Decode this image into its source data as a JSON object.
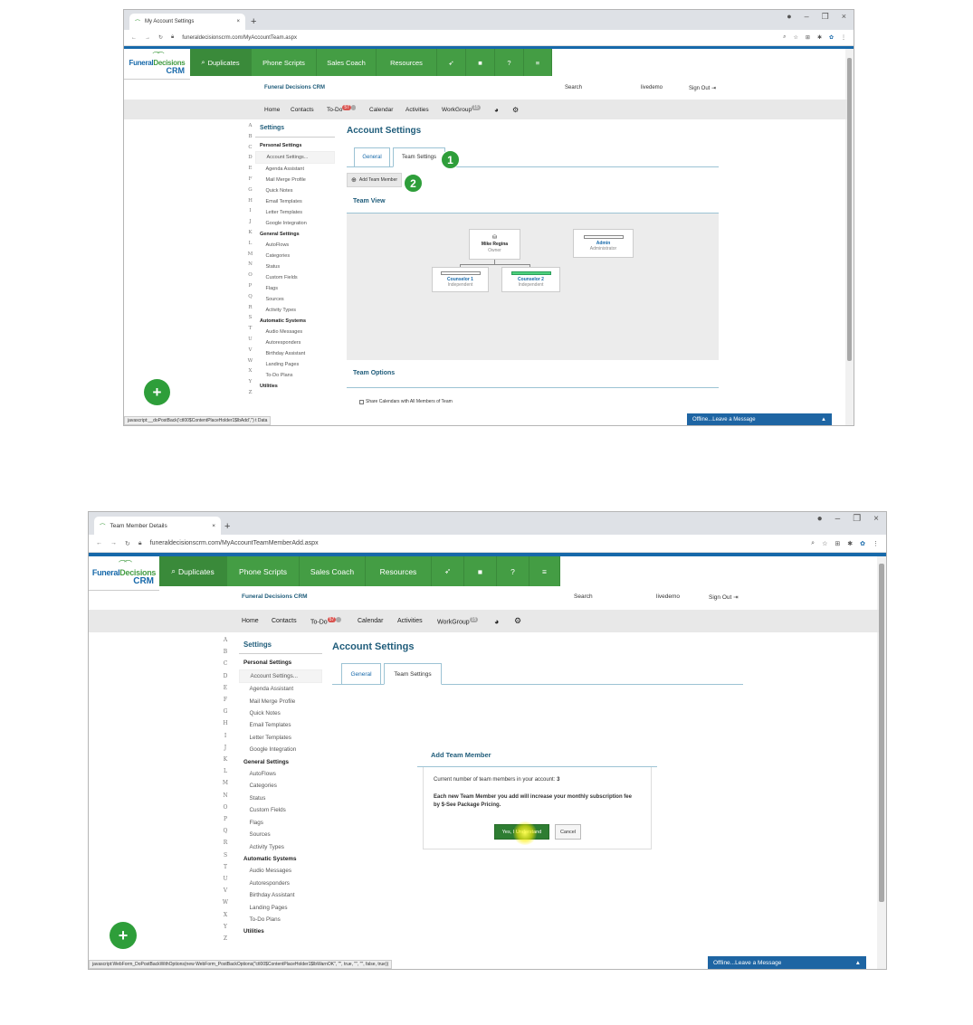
{
  "s1": {
    "tab_title": "My Account Settings",
    "url": "funeraldecisionscrm.com/MyAccountTeam.aspx",
    "page_title": "Account Settings",
    "tabs": [
      "General",
      "Team Settings"
    ],
    "marker1": "1",
    "marker2": "2",
    "add_btn": "Add Team Member",
    "team_view": "Team View",
    "nodes": {
      "owner_name": "Mike Regina",
      "owner_role": "Owner",
      "admin_name": "Admin",
      "admin_role": "Administrator",
      "c1_name": "Counselor 1",
      "c1_role": "Independent",
      "c2_name": "Counselor 2",
      "c2_role": "Independent"
    },
    "team_options": "Team Options",
    "share_cal": "Share Calendars with All Members of Team",
    "status": "javascript:__doPostBack('ctl00$ContentPlaceHolder1$lbAdd','') t Data"
  },
  "s2": {
    "tab_title": "Team Member Details",
    "url": "funeraldecisionscrm.com/MyAccountTeamMemberAdd.aspx",
    "page_title": "Account Settings",
    "tabs": [
      "General",
      "Team Settings"
    ],
    "modal": {
      "title": "Add Team Member",
      "count_prefix": "Current number of team members in your account:",
      "count": "3",
      "warning": "Each new Team Member you add will increase your monthly subscription fee by $-See Package Pricing.",
      "ok": "Yes, I Understand",
      "cancel": "Cancel"
    },
    "status": "javascript:WebForm_DoPostBackWithOptions(new WebForm_PostBackOptions(\"ctl00$ContentPlaceHolder1$lbWarnOK\", \"\", true, \"\", \"\", false, true))"
  },
  "logo": {
    "part1": "Funeral",
    "part2": "Decisions",
    "crm": "CRM"
  },
  "green_nav": {
    "duplicates": "Duplicates",
    "phone_scripts": "Phone Scripts",
    "sales_coach": "Sales Coach",
    "resources": "Resources"
  },
  "sub_header": {
    "brand": "Funeral Decisions CRM",
    "search": "Search",
    "user": "livedemo",
    "signout": "Sign Out"
  },
  "main_nav": {
    "home": "Home",
    "contacts": "Contacts",
    "todo": "To-Do",
    "todo_badge": "57",
    "calendar": "Calendar",
    "activities": "Activities",
    "workgroup": "WorkGroup",
    "workgroup_badge": "15"
  },
  "alphabet": [
    "A",
    "B",
    "C",
    "D",
    "E",
    "F",
    "G",
    "H",
    "I",
    "J",
    "K",
    "L",
    "M",
    "N",
    "O",
    "P",
    "Q",
    "R",
    "S",
    "T",
    "U",
    "V",
    "W",
    "X",
    "Y",
    "Z"
  ],
  "sidebar": {
    "heading": "Settings",
    "personal": "Personal Settings",
    "personal_items": [
      "Account Settings...",
      "Agenda Assistant",
      "Mail Merge Profile",
      "Quick Notes",
      "Email Templates",
      "Letter Templates",
      "Google Integration"
    ],
    "general": "General Settings",
    "general_items": [
      "AutoFlows",
      "Categories",
      "Status",
      "Custom Fields",
      "Flags",
      "Sources",
      "Activity Types"
    ],
    "automatic": "Automatic Systems",
    "automatic_items": [
      "Audio Messages",
      "Autoresponders",
      "Birthday Assistant",
      "Landing Pages",
      "To-Do Plans"
    ],
    "utilities": "Utilities"
  },
  "chat": {
    "label": "Offline...Leave a Message"
  },
  "colors": {
    "green": "#449d44",
    "blue": "#1769aa",
    "teal": "#1f5c7a",
    "marker": "#2e9e3a"
  }
}
